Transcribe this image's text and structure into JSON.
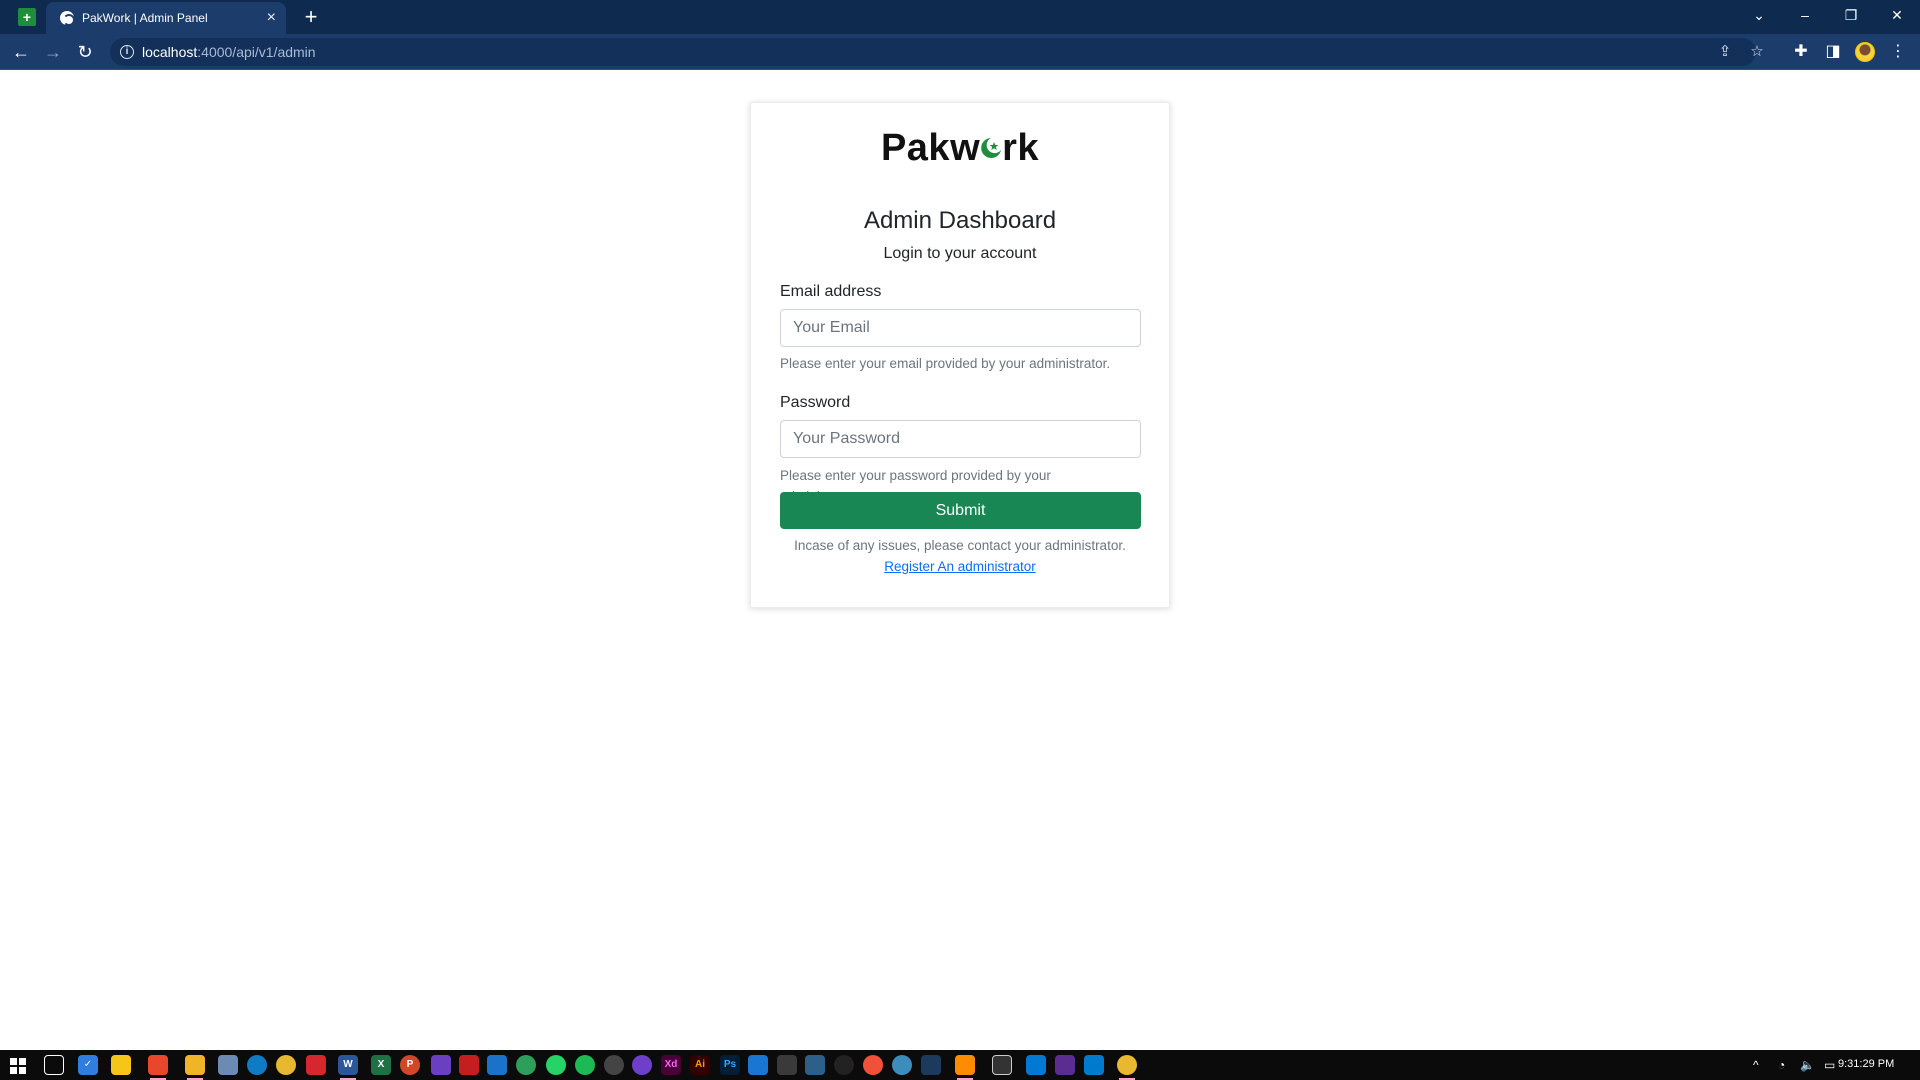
{
  "browser": {
    "tab_title": "PakWork | Admin Panel",
    "new_tab_symbol": "+",
    "close_symbol": "×",
    "url_host": "localhost",
    "url_path": ":4000/api/v1/admin",
    "icons": [
      "back-arrow-icon",
      "forward-arrow-icon",
      "reload-icon",
      "info-icon",
      "share-icon",
      "star-icon",
      "extensions-icon",
      "side-panel-icon",
      "profile-avatar",
      "menu-dots-icon"
    ]
  },
  "login": {
    "logo_prefix": "Pakw",
    "logo_suffix": "rk",
    "title": "Admin Dashboard",
    "subtitle": "Login to your account",
    "email_label": "Email address",
    "email_placeholder": "Your Email",
    "email_help": "Please enter your email provided by your administrator.",
    "password_label": "Password",
    "password_placeholder": "Your Password",
    "password_help": "Please enter your password provided by your administrator.",
    "submit_label": "Submit",
    "footnote": "Incase of any issues, please contact your administrator.",
    "register_link": "Register An administrator"
  },
  "colors": {
    "chrome_dark": "#0e2a4f",
    "chrome_toolbar": "#1c3c6b",
    "submit_green": "#198754",
    "logo_green": "#1e8e3e",
    "link_blue": "#0d6efd"
  },
  "taskbar": {
    "clock": "9:31:29 PM"
  }
}
